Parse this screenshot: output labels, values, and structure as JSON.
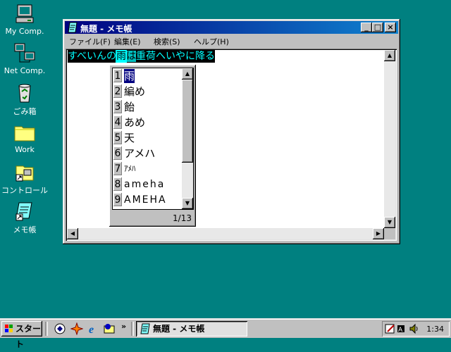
{
  "desktop": {
    "icons": [
      {
        "label": "My Comp.",
        "icon": "computer-icon"
      },
      {
        "label": "Net Comp.",
        "icon": "network-icon"
      },
      {
        "label": "ごみ箱",
        "icon": "recycle-bin-icon"
      },
      {
        "label": "Work",
        "icon": "folder-icon"
      },
      {
        "label": "コントロール",
        "icon": "control-panel-icon"
      },
      {
        "label": "メモ帳",
        "icon": "notepad-icon"
      }
    ]
  },
  "window": {
    "title": "無題 - メモ帳",
    "controls": {
      "minimize": "_",
      "maximize": "□",
      "close": "×"
    },
    "menu": [
      "ファイル(F)",
      "編集(E)",
      "検索(S)",
      "ヘルプ(H)"
    ],
    "text": {
      "before": "すべいんの",
      "selected": "雨",
      "cursor": "は",
      "after": "重荷へいやに降る"
    }
  },
  "ime": {
    "candidates": [
      {
        "n": "1",
        "text": "雨"
      },
      {
        "n": "2",
        "text": "編め"
      },
      {
        "n": "3",
        "text": "飴"
      },
      {
        "n": "4",
        "text": "あめ"
      },
      {
        "n": "5",
        "text": "天"
      },
      {
        "n": "6",
        "text": "アメハ"
      },
      {
        "n": "7",
        "text": "ｱﾒﾊ"
      },
      {
        "n": "8",
        "text": "ameha"
      },
      {
        "n": "9",
        "text": "AMEHA"
      }
    ],
    "count": "1/13",
    "selected_index": 1
  },
  "taskbar": {
    "start_label": "スタート",
    "task_label": "無題 - メモ帳",
    "quick_launch": [
      "browser-icon",
      "channel-icon",
      "ie-icon",
      "outlook-icon"
    ],
    "overflow": "»",
    "clock": "1:34"
  }
}
